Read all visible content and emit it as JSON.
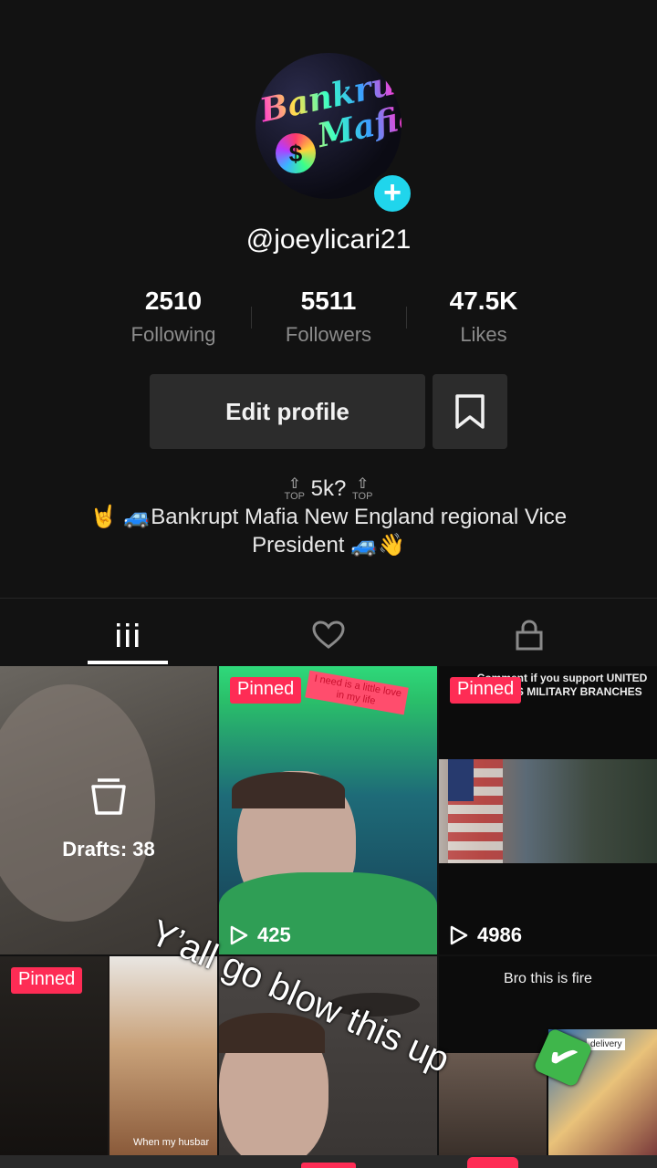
{
  "profile": {
    "username": "@joeylicari21",
    "avatar_text_line1": "Bankrupt",
    "avatar_text_line2": "Mafia",
    "avatar_symbol": "$"
  },
  "stats": {
    "following": {
      "value": "2510",
      "label": "Following"
    },
    "followers": {
      "value": "5511",
      "label": "Followers"
    },
    "likes": {
      "value": "47.5K",
      "label": "Likes"
    }
  },
  "actions": {
    "edit_profile_label": "Edit profile"
  },
  "bio": {
    "line1": "5k?",
    "badge_label": "TOP",
    "line2": "🤘 🚙Bankrupt Mafia New England regional Vice President 🚙👋"
  },
  "tabs": [
    {
      "name": "videos",
      "icon": "grid-icon"
    },
    {
      "name": "liked",
      "icon": "heart-icon"
    },
    {
      "name": "private",
      "icon": "lock-icon"
    }
  ],
  "grid": {
    "drafts_label": "Drafts: 38",
    "pinned_label": "Pinned",
    "video2_caption": "I need is a little love in my life",
    "video2_views": "425",
    "video3_caption": "Comment if you support UNITED STATES MILITARY BRANCHES",
    "video3_views": "4986",
    "video4_caption": "When my husbar",
    "video6_caption": "Bro this is fire",
    "video6_sub": "delivery"
  },
  "overlay": {
    "caption": "Y’all go blow this up",
    "emoji": "✔"
  },
  "colors": {
    "background": "#121212",
    "accent": "#fe2c55",
    "add_badge": "#20d5ec",
    "button_bg": "#2c2c2c"
  }
}
